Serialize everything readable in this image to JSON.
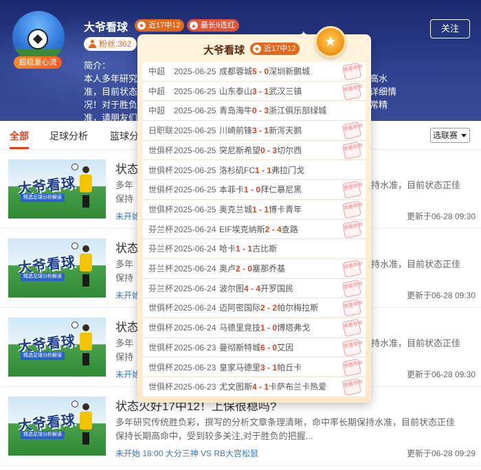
{
  "header": {
    "expert_name": "大爷看球",
    "badge_recent": "近17中12",
    "badge_streak": "最长9连红",
    "avatar_tag": "超稳重心流",
    "fans_label": "粉丝:362",
    "follow_label": "关注",
    "intro_title": "简介：",
    "intro_lines": [
      "本人多年研究",
      "准，目前状态",
      "况！对于胜负",
      "准，请朋友们"
    ],
    "intro_right": [
      "高水",
      "详细情",
      "常精"
    ]
  },
  "tabs": {
    "items": [
      "全部",
      "足球分析",
      "篮球分"
    ],
    "active": 0,
    "league_select": "选联赛"
  },
  "articles": [
    {
      "title": "状态",
      "desc_tail": "持水准，目前状态正佳",
      "desc_lines": [
        "多年",
        "保持"
      ],
      "meta": "未开始",
      "time": "更新于06-28 09:30"
    },
    {
      "title": "状态",
      "desc_tail": "持水准，目前状态正佳",
      "desc_lines": [
        "多年",
        "保持"
      ],
      "meta": "未开始",
      "time": "更新于06-28 09:30"
    },
    {
      "title": "状态",
      "desc_tail": "持水准，目前状态正佳",
      "desc_lines": [
        "多年",
        "保持"
      ],
      "meta": "未开始",
      "time": "更新于06-28 09:30"
    },
    {
      "title": "状态火好17中12！上保很稳吗?",
      "desc_lines": [
        "多年研究传统胜负彩，撰写的分析文章条理清晰，命中率长期保持水准，目前状态正佳",
        "保持长期高命中，受到较多关注,对于胜负的把握..."
      ],
      "meta": "未开始 18:00 大分三神 VS RB大宫松鼠",
      "time": "更新于06-28 09:29"
    }
  ],
  "thumbnail": {
    "title": "大爷看球",
    "subtitle": "精选足球分析解读"
  },
  "popup": {
    "name": "大爷看球",
    "badge": "近17中12",
    "stamp_text": "恭喜命中",
    "results": [
      {
        "league": "中超",
        "date": "2025-06-25",
        "home": "成都蓉城",
        "hs": "5",
        "as": "0",
        "away": "深圳新鹏城",
        "hit": true
      },
      {
        "league": "中超",
        "date": "2025-06-25",
        "home": "山东泰山",
        "hs": "3",
        "as": "1",
        "away": "武汉三镇",
        "hit": true
      },
      {
        "league": "中超",
        "date": "2025-06-25",
        "home": "青岛海牛",
        "hs": "0",
        "as": "3",
        "away": "浙江俱乐部绿城",
        "hit": false
      },
      {
        "league": "日职联",
        "date": "2025-06-25",
        "home": "川崎前锋",
        "hs": "3",
        "as": "1",
        "away": "新泻天鹅",
        "hit": true
      },
      {
        "league": "世俱杯",
        "date": "2025-06-25",
        "home": "突尼斯希望",
        "hs": "0",
        "as": "3",
        "away": "切尔西",
        "hit": true
      },
      {
        "league": "世俱杯",
        "date": "2025-06-25",
        "home": "洛杉矶FC",
        "hs": "1",
        "as": "1",
        "away": "弗拉门戈",
        "hit": false
      },
      {
        "league": "世俱杯",
        "date": "2025-06-25",
        "home": "本菲卡",
        "hs": "1",
        "as": "0",
        "away": "拜仁慕尼黑",
        "hit": true
      },
      {
        "league": "世俱杯",
        "date": "2025-06-25",
        "home": "奥克兰城",
        "hs": "1",
        "as": "1",
        "away": "博卡青年",
        "hit": true
      },
      {
        "league": "芬兰杯",
        "date": "2025-06-24",
        "home": "EIF埃克纳斯",
        "hs": "2",
        "as": "4",
        "away": "查路",
        "hit": true
      },
      {
        "league": "芬兰杯",
        "date": "2025-06-24",
        "home": "哈卡",
        "hs": "1",
        "as": "1",
        "away": "古比斯",
        "hit": false
      },
      {
        "league": "芬兰杯",
        "date": "2025-06-24",
        "home": "奥卢",
        "hs": "2",
        "as": "0",
        "away": "塞那乔基",
        "hit": true
      },
      {
        "league": "芬兰杯",
        "date": "2025-06-24",
        "home": "波尔图",
        "hs": "4",
        "as": "4",
        "away": "开罗国民",
        "hit": true
      },
      {
        "league": "世俱杯",
        "date": "2025-06-24",
        "home": "迈阿密国际",
        "hs": "2",
        "as": "2",
        "away": "帕尔梅拉斯",
        "hit": true
      },
      {
        "league": "世俱杯",
        "date": "2025-06-24",
        "home": "马德里竞技",
        "hs": "1",
        "as": "0",
        "away": "博塔弗戈",
        "hit": true
      },
      {
        "league": "世俱杯",
        "date": "2025-06-23",
        "home": "曼彻斯特城",
        "hs": "6",
        "as": "0",
        "away": "艾因",
        "hit": true
      },
      {
        "league": "世俱杯",
        "date": "2025-06-23",
        "home": "皇家马德里",
        "hs": "3",
        "as": "1",
        "away": "帕丘卡",
        "hit": true
      },
      {
        "league": "世俱杯",
        "date": "2025-06-23",
        "home": "尤文图斯",
        "hs": "4",
        "as": "1",
        "away": "卡萨布兰卡热爱",
        "hit": true
      }
    ]
  }
}
